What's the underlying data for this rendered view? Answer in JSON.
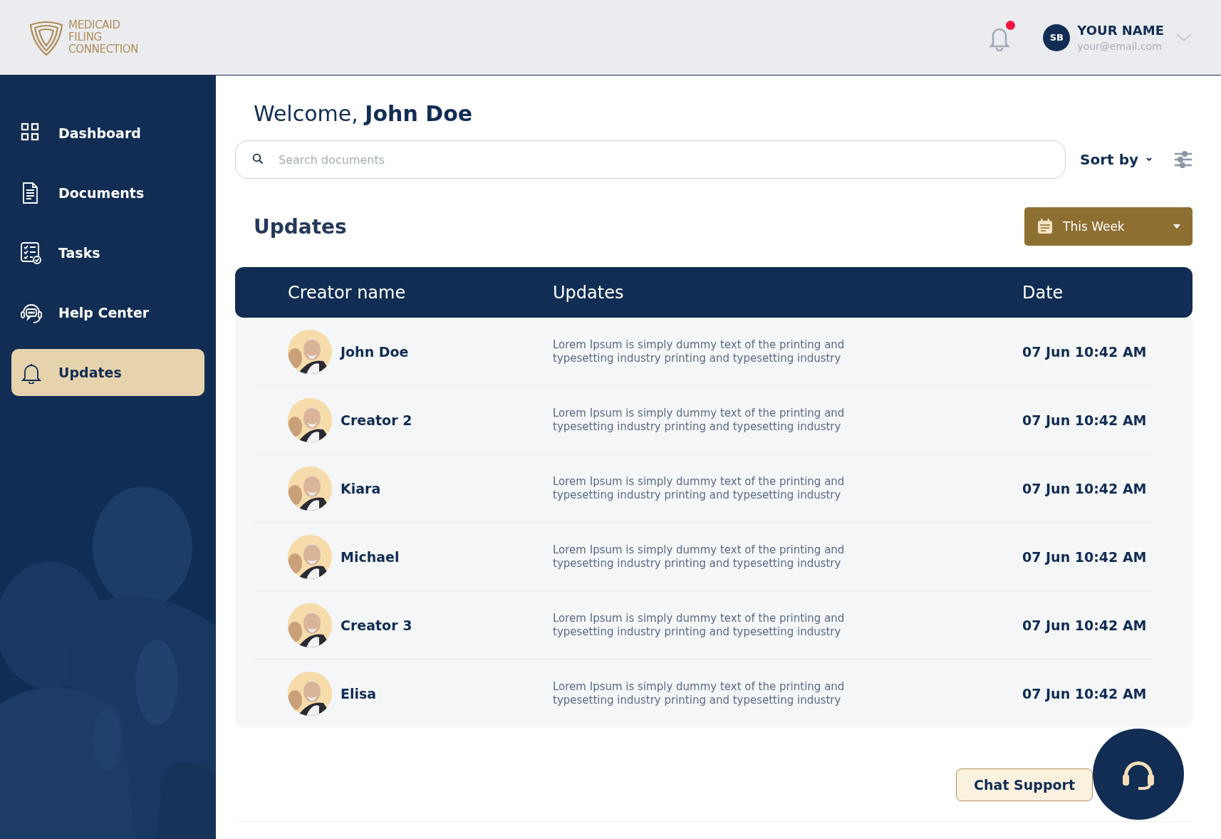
{
  "brand": {
    "lines": [
      "MEDICAID",
      "FILING",
      "CONNECTION"
    ]
  },
  "header": {
    "notifications": {
      "unread": true
    },
    "user": {
      "initials": "SB",
      "name": "YOUR NAME",
      "email": "your@email.com"
    }
  },
  "sidebar": {
    "items": [
      {
        "label": "Dashboard",
        "kind": "dashboard",
        "selected": false
      },
      {
        "label": "Documents",
        "kind": "documents",
        "selected": false
      },
      {
        "label": "Tasks",
        "kind": "tasks",
        "selected": false
      },
      {
        "label": "Help Center",
        "kind": "help",
        "selected": false
      },
      {
        "label": "Updates",
        "kind": "updates",
        "selected": true
      }
    ]
  },
  "welcome": {
    "greeting": "Welcome,",
    "name": "John Doe"
  },
  "search": {
    "placeholder": "Search documents"
  },
  "sort": {
    "label": "Sort by"
  },
  "section": {
    "title": "Updates",
    "period": "This Week"
  },
  "table": {
    "columns": [
      "Creator name",
      "Updates",
      "Date"
    ],
    "rows": [
      {
        "creator": "John Doe",
        "update": "Lorem Ipsum is simply dummy text of the printing and typesetting industry printing and typesetting industry",
        "date": "07 Jun 10:42 AM"
      },
      {
        "creator": "Creator 2",
        "update": "Lorem Ipsum is simply dummy text of the printing and typesetting industry printing and typesetting industry",
        "date": "07 Jun 10:42 AM"
      },
      {
        "creator": "Kiara",
        "update": "Lorem Ipsum is simply dummy text of the printing and typesetting industry printing and typesetting industry",
        "date": "07 Jun 10:42 AM"
      },
      {
        "creator": "Michael",
        "update": "Lorem Ipsum is simply dummy text of the printing and typesetting industry printing and typesetting industry",
        "date": "07 Jun 10:42 AM"
      },
      {
        "creator": "Creator 3",
        "update": "Lorem Ipsum is simply dummy text of the printing and typesetting industry printing and typesetting industry",
        "date": "07 Jun 10:42 AM"
      },
      {
        "creator": "Elisa",
        "update": "Lorem Ipsum is simply dummy text of the printing and typesetting industry printing and typesetting industry",
        "date": "07 Jun 10:42 AM"
      }
    ]
  },
  "chat": {
    "label": "Chat Support"
  }
}
